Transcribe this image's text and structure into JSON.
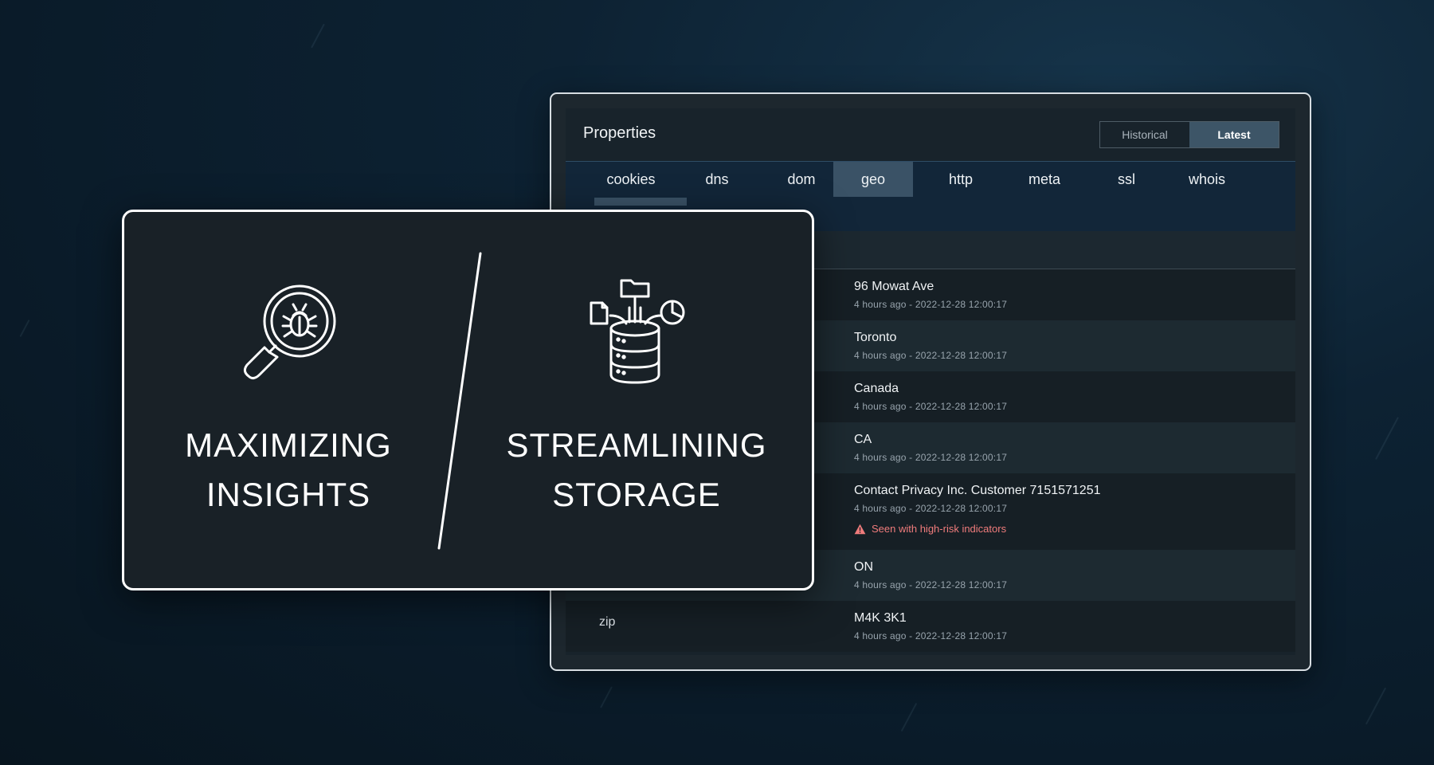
{
  "headline": {
    "left_line1": "MAXIMIZING",
    "left_line2": "INSIGHTS",
    "right_line1": "STREAMLINING",
    "right_line2": "STORAGE",
    "left_icon": "bug-magnifier-icon",
    "right_icon": "database-data-sources-icon"
  },
  "panel": {
    "title": "Properties",
    "toggle": {
      "historical": "Historical",
      "latest": "Latest",
      "selected": "Latest"
    },
    "tabs": [
      {
        "label": "cookies"
      },
      {
        "label": "dns"
      },
      {
        "label": "dom"
      },
      {
        "label": "geo",
        "active": true
      },
      {
        "label": "http"
      },
      {
        "label": "meta"
      },
      {
        "label": "ssl"
      },
      {
        "label": "whois"
      }
    ],
    "rows": [
      {
        "key": "",
        "value": "96 Mowat Ave",
        "meta": "4 hours ago - 2022-12-28 12:00:17"
      },
      {
        "key": "",
        "value": "Toronto",
        "meta": "4 hours ago - 2022-12-28 12:00:17"
      },
      {
        "key": "",
        "value": "Canada",
        "meta": "4 hours ago - 2022-12-28 12:00:17"
      },
      {
        "key": "",
        "value": "CA",
        "meta": "4 hours ago - 2022-12-28 12:00:17"
      },
      {
        "key": "",
        "value": "Contact Privacy Inc. Customer 7151571251",
        "meta": "4 hours ago - 2022-12-28 12:00:17",
        "alert": "Seen with high-risk indicators"
      },
      {
        "key": "",
        "value": "ON",
        "meta": "4 hours ago - 2022-12-28 12:00:17"
      },
      {
        "key": "zip",
        "value": "M4K 3K1",
        "meta": "4 hours ago - 2022-12-28 12:00:17"
      }
    ]
  },
  "colors": {
    "background": "#0a1b29",
    "panel_tab_bar": "#122639",
    "active_tab": "#3a5266",
    "alert": "#f07c7c",
    "card_border": "#ffffff"
  }
}
